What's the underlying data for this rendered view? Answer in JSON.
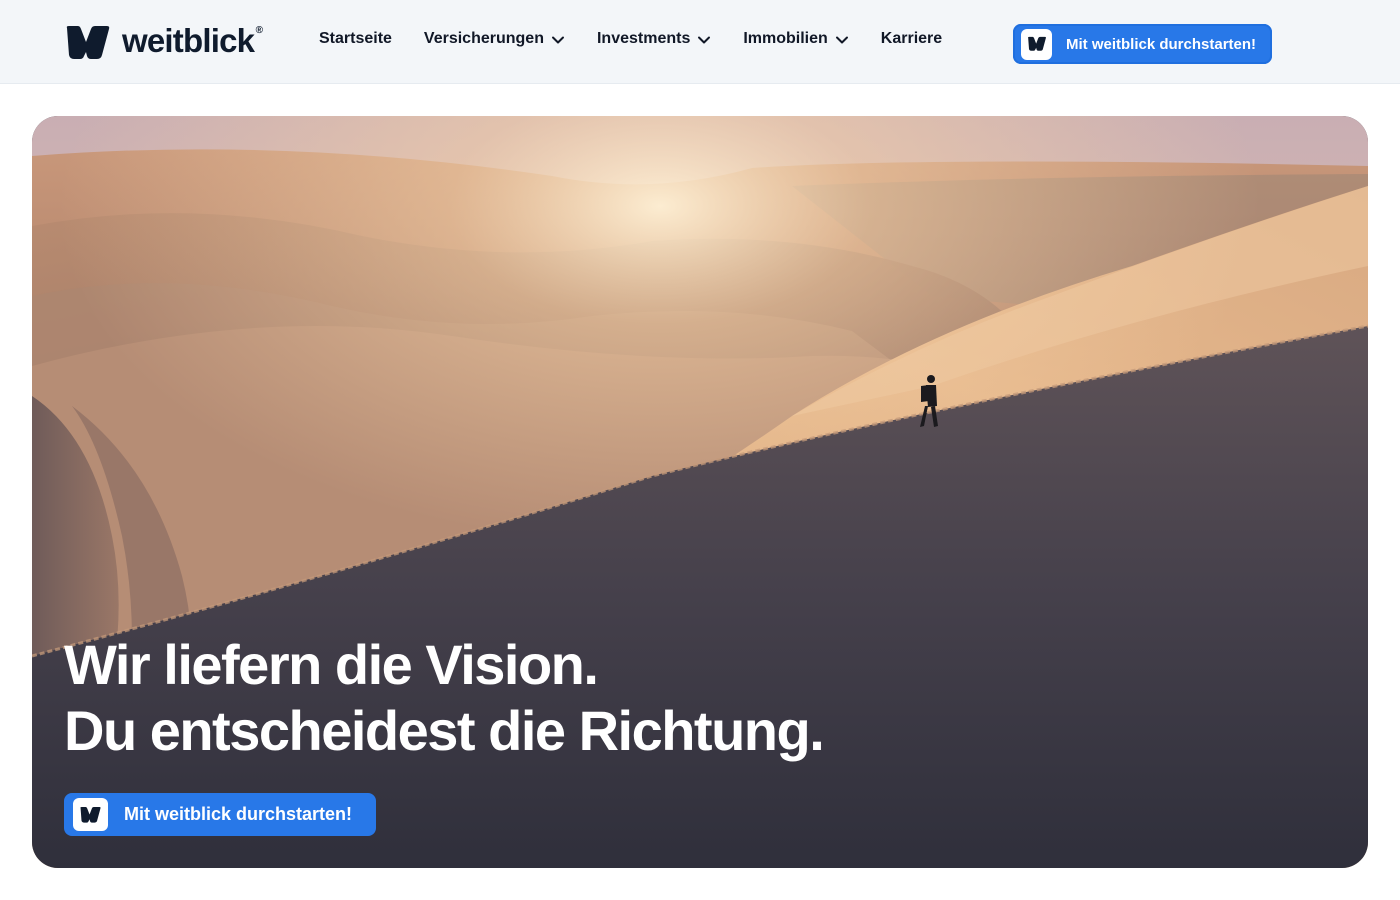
{
  "header": {
    "brand": "weitblick",
    "brand_reg": "®",
    "nav": [
      {
        "label": "Startseite",
        "has_dropdown": false
      },
      {
        "label": "Versicherungen",
        "has_dropdown": true
      },
      {
        "label": "Investments",
        "has_dropdown": true
      },
      {
        "label": "Immobilien",
        "has_dropdown": true
      },
      {
        "label": "Karriere",
        "has_dropdown": false
      }
    ],
    "cta_label": "Mit weitblick durchstarten!"
  },
  "hero": {
    "headline_line1": "Wir liefern die Vision.",
    "headline_line2": "Du entscheidest die Richtung.",
    "cta_label": "Mit weitblick durchstarten!"
  },
  "icons": {
    "logo": "weitblick-logo-icon",
    "dropdown": "chevron-down-icon"
  },
  "colors": {
    "accent": "#2878e8",
    "brand_dark": "#0f1b2d",
    "header_bg": "#f3f6f9"
  }
}
